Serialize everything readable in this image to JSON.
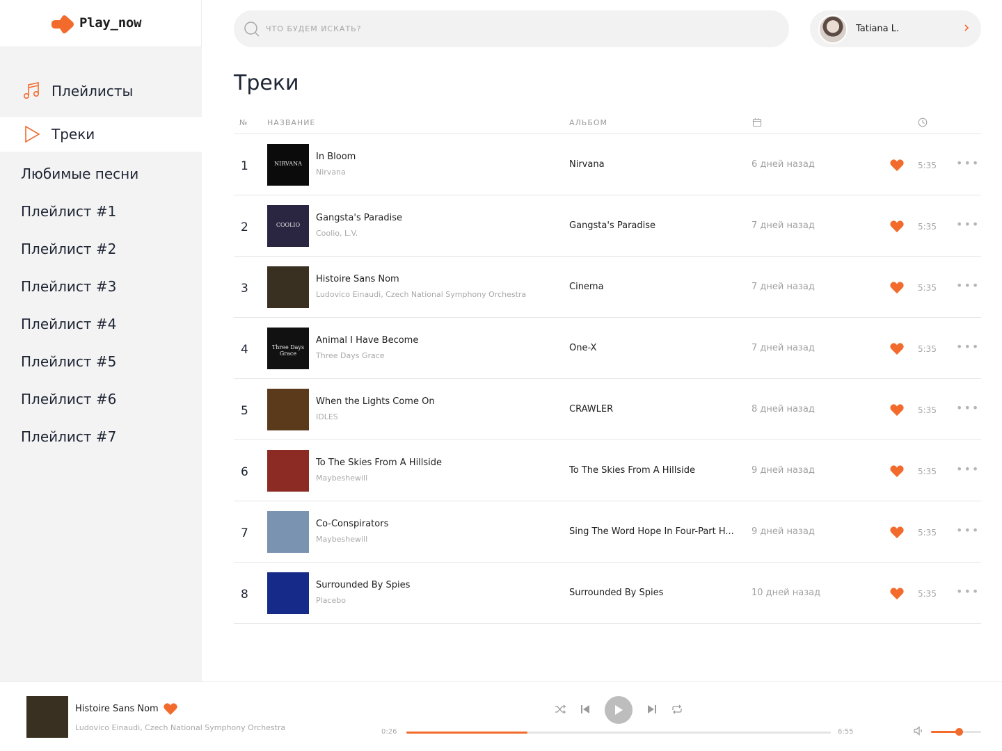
{
  "brand": {
    "logo_text": "Play_now",
    "accent": "#f26b2c"
  },
  "sidebar": {
    "playlists_label": "Плейлисты",
    "tracks_label": "Треки",
    "items": [
      "Любимые песни",
      "Плейлист #1",
      "Плейлист #2",
      "Плейлист #3",
      "Плейлист #4",
      "Плейлист #5",
      "Плейлист #6",
      "Плейлист #7"
    ]
  },
  "search": {
    "placeholder": "ЧТО БУДЕМ ИСКАТЬ?"
  },
  "user": {
    "name": "Tatiana L."
  },
  "page": {
    "title": "Треки"
  },
  "table": {
    "headers": {
      "num": "№",
      "title": "НАЗВАНИЕ",
      "album": "АЛЬБОМ",
      "date_icon": "calendar-icon",
      "duration_icon": "clock-icon"
    },
    "rows": [
      {
        "num": "1",
        "title": "In Bloom",
        "artist": "Nirvana",
        "album": "Nirvana",
        "date": "6 дней назад",
        "duration": "5:35",
        "cover_color": "#0b0b0b",
        "cover_text": "NIRVANA"
      },
      {
        "num": "2",
        "title": "Gangsta's Paradise",
        "artist": "Coolio, L.V.",
        "album": "Gangsta's Paradise",
        "date": "7 дней назад",
        "duration": "5:35",
        "cover_color": "#2a2540",
        "cover_text": "COOLIO"
      },
      {
        "num": "3",
        "title": "Histoire Sans Nom",
        "artist": "Ludovico Einaudi, Czech National Symphony Orchestra",
        "album": "Cinema",
        "date": "7 дней назад",
        "duration": "5:35",
        "cover_color": "#3a3021",
        "cover_text": ""
      },
      {
        "num": "4",
        "title": "Animal I Have Become",
        "artist": "Three Days Grace",
        "album": "One-X",
        "date": "7 дней назад",
        "duration": "5:35",
        "cover_color": "#111111",
        "cover_text": "Three Days Grace"
      },
      {
        "num": "5",
        "title": "When the Lights Come On",
        "artist": "IDLES",
        "album": "CRAWLER",
        "date": "8 дней назад",
        "duration": "5:35",
        "cover_color": "#5b3a1c",
        "cover_text": ""
      },
      {
        "num": "6",
        "title": "To The Skies From A Hillside",
        "artist": "Maybeshewill",
        "album": "To The Skies From A Hillside",
        "date": "9 дней назад",
        "duration": "5:35",
        "cover_color": "#8c2a24",
        "cover_text": ""
      },
      {
        "num": "7",
        "title": "Co-Conspirators",
        "artist": "Maybeshewill",
        "album": "Sing The Word Hope In Four-Part H...",
        "date": "9 дней назад",
        "duration": "5:35",
        "cover_color": "#7a93b1",
        "cover_text": ""
      },
      {
        "num": "8",
        "title": "Surrounded By Spies",
        "artist": "Placebo",
        "album": "Surrounded By Spies",
        "date": "10 дней назад",
        "duration": "5:35",
        "cover_color": "#162a8a",
        "cover_text": ""
      }
    ]
  },
  "player": {
    "title": "Histoire Sans Nom",
    "artist": "Ludovico Einaudi, Czech National Symphony Orchestra",
    "current_time": "0:26",
    "total_time": "6:55",
    "progress_percent": 28.5,
    "volume_percent": 55
  }
}
